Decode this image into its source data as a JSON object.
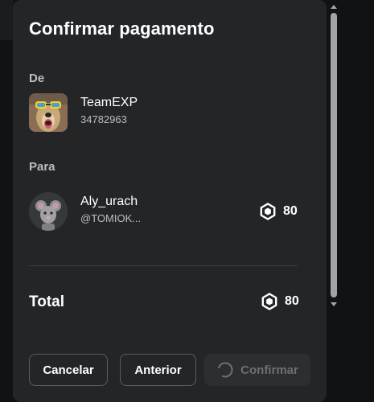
{
  "dialog": {
    "title": "Confirmar pagamento"
  },
  "from": {
    "label": "De",
    "name": "TeamEXP",
    "id": "34782963"
  },
  "to": {
    "label": "Para",
    "name": "Aly_urach",
    "handle": "@TOMIOK...",
    "amount": "80"
  },
  "total": {
    "label": "Total",
    "amount": "80"
  },
  "buttons": {
    "cancel": "Cancelar",
    "back": "Anterior",
    "confirm": "Confirmar"
  },
  "icons": {
    "currency": "robux-icon",
    "loading": "spinner-icon"
  },
  "colors": {
    "modal_bg": "#232527",
    "text_primary": "#ffffff",
    "text_secondary": "#bdbebe",
    "button_border": "#5a5c5f",
    "disabled_text": "#6d6f72"
  }
}
